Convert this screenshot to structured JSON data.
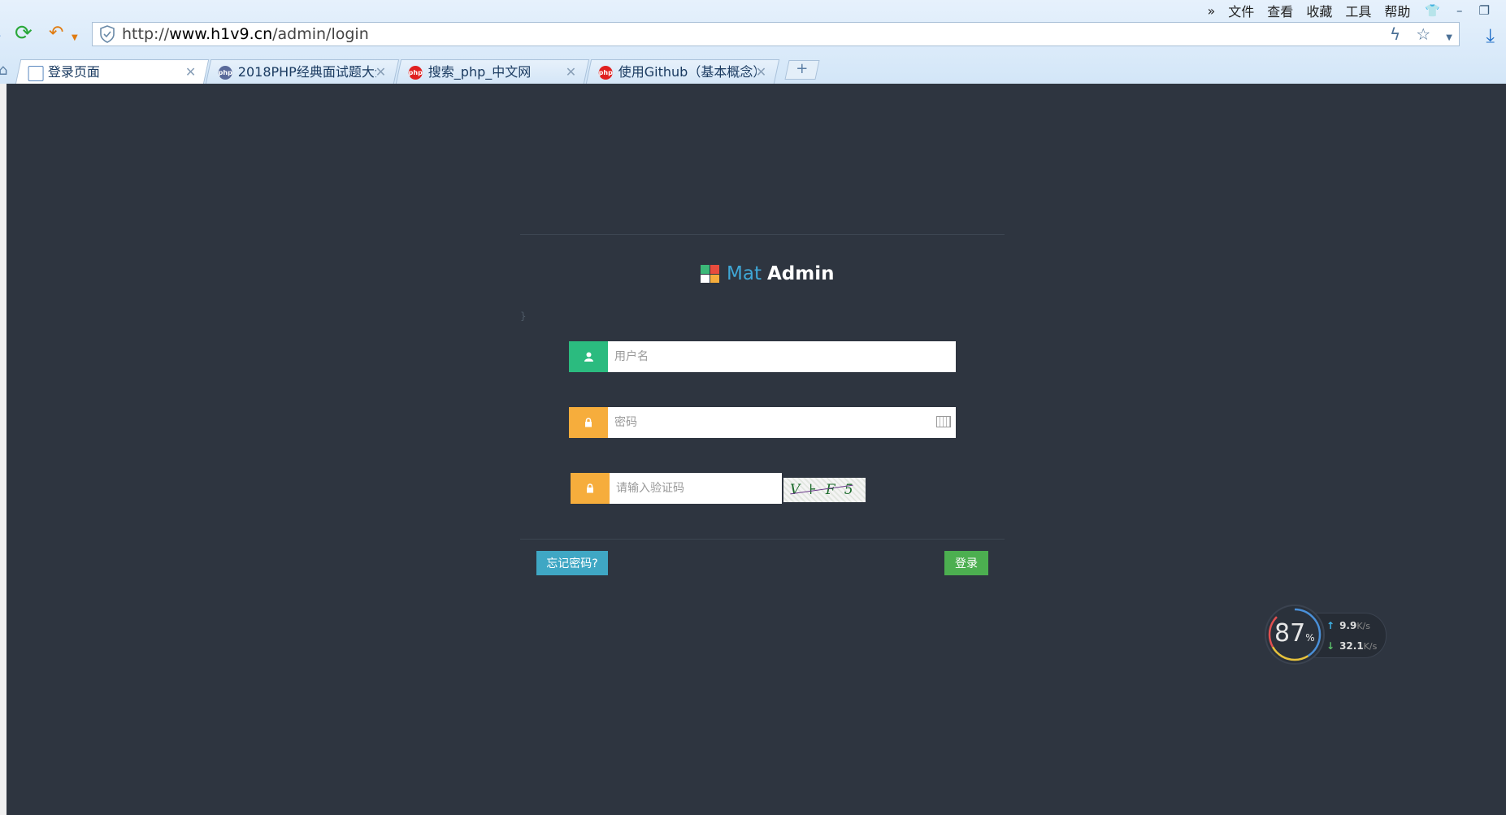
{
  "browser": {
    "menu": [
      "文件",
      "查看",
      "收藏",
      "工具",
      "帮助"
    ],
    "address": {
      "prefix": "http://",
      "host": "www.h1v9.cn",
      "path": "/admin/login"
    },
    "tabs": [
      {
        "label": "登录页面",
        "favicon": "page-icon"
      },
      {
        "label": "2018PHP经典面试题大全",
        "favicon": "php-icon"
      },
      {
        "label": "搜索_php_中文网",
        "favicon": "php-cn-icon"
      },
      {
        "label": "使用Github（基本概念）",
        "favicon": "php-cn-icon"
      }
    ],
    "newtab_label": "+"
  },
  "login": {
    "brand_mat": "Mat",
    "brand_admin": "Admin",
    "stray_text": "}",
    "username_placeholder": "用户名",
    "password_placeholder": "密码",
    "captcha_placeholder": "请输入验证码",
    "captcha_text": "V⊦F5",
    "forgot_label": "忘记密码?",
    "login_label": "登录",
    "colors": {
      "user_addon": "#2bbb7f",
      "lock_addon": "#f6ad3c",
      "forgot_bg": "#3fa7c4",
      "login_bg": "#4caf50"
    }
  },
  "speed_widget": {
    "cpu_value": "87",
    "cpu_unit": "%",
    "upload": "9.9",
    "upload_unit": "K/s",
    "download": "32.1",
    "download_unit": "K/s"
  }
}
